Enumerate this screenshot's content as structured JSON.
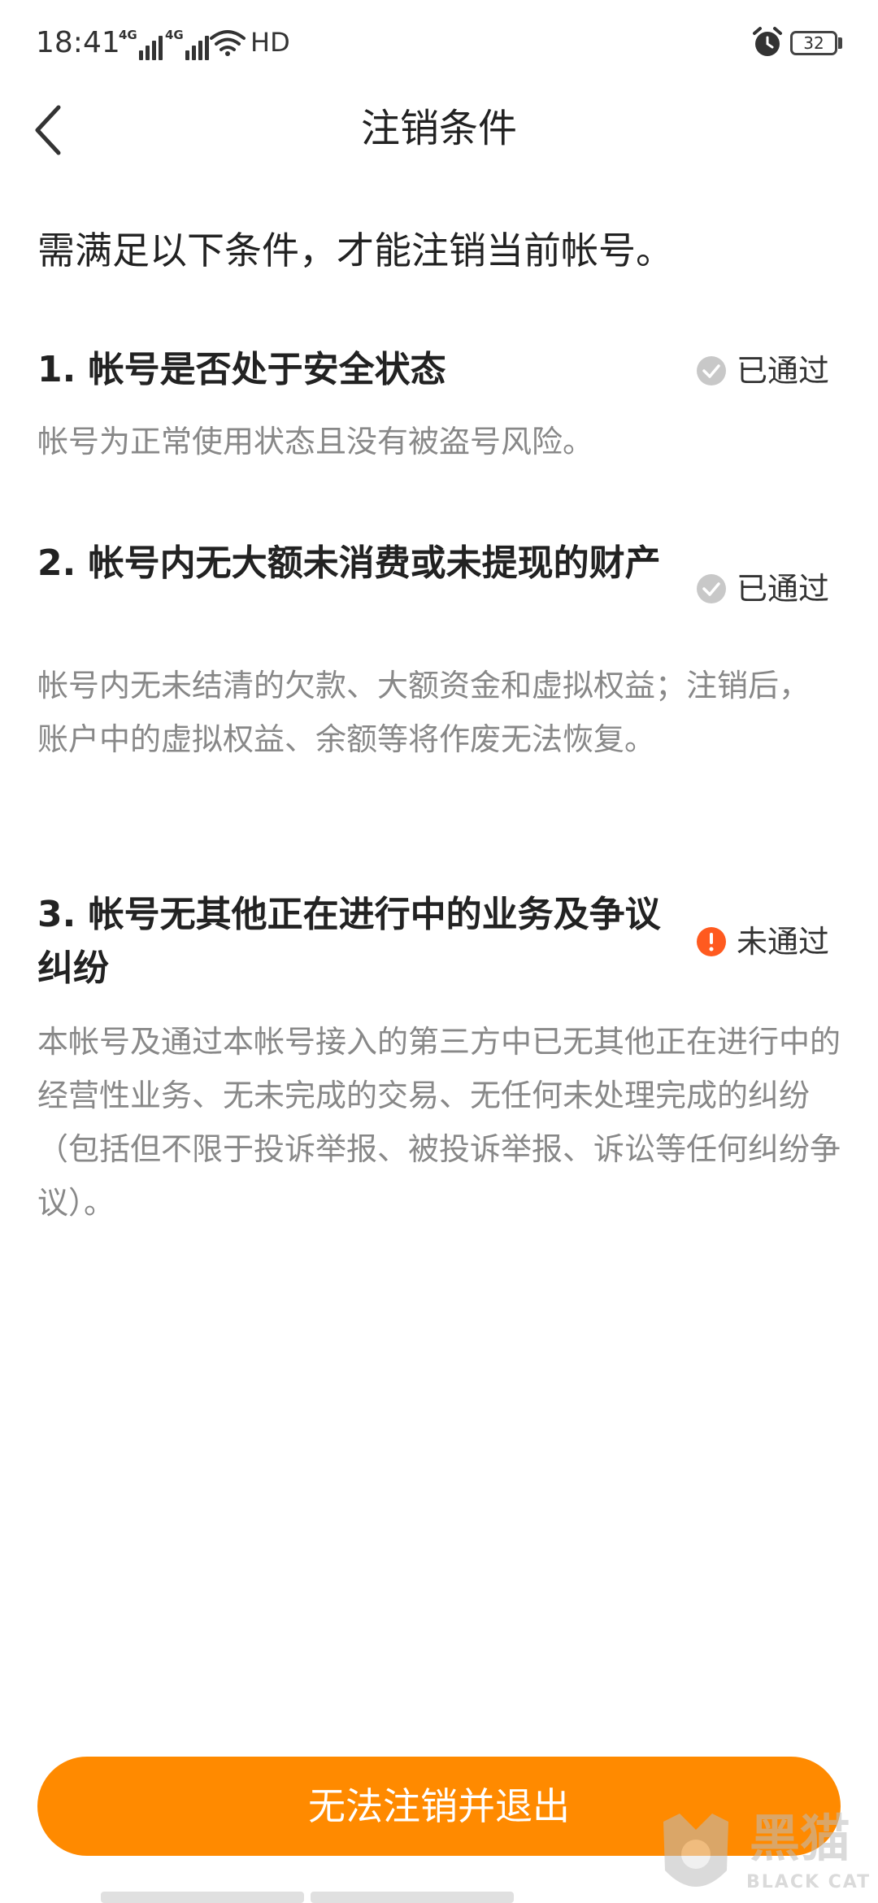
{
  "status_bar": {
    "time": "18:41",
    "network_1": "4G",
    "network_2": "4G",
    "hd": "HD",
    "battery": "32"
  },
  "header": {
    "title": "注销条件"
  },
  "intro": "需满足以下条件，才能注销当前帐号。",
  "conditions": [
    {
      "title": "1. 帐号是否处于安全状态",
      "status": "已通过",
      "description": "帐号为正常使用状态且没有被盗号风险。"
    },
    {
      "title": "2. 帐号内无大额未消费或未提现的财产",
      "status": "已通过",
      "description": "帐号内无未结清的欠款、大额资金和虚拟权益；注销后，账户中的虚拟权益、余额等将作废无法恢复。"
    },
    {
      "title": "3. 帐号无其他正在进行中的业务及争议纠纷",
      "status": "未通过",
      "description": "本帐号及通过本帐号接入的第三方中已无其他正在进行中的经营性业务、无未完成的交易、无任何未处理完成的纠纷（包括但不限于投诉举报、被投诉举报、诉讼等任何纠纷争议）。"
    }
  ],
  "footer": {
    "button_label": "无法注销并退出"
  },
  "watermark": {
    "cn": "黑猫",
    "en": "BLACK CAT"
  },
  "colors": {
    "accent": "#ff8a00",
    "passed_icon": "#c8c8c8",
    "failed_icon": "#ff5a1f"
  },
  "icons": {
    "passed": "check-circle-icon",
    "failed": "exclamation-circle-icon",
    "back": "chevron-left-icon"
  }
}
